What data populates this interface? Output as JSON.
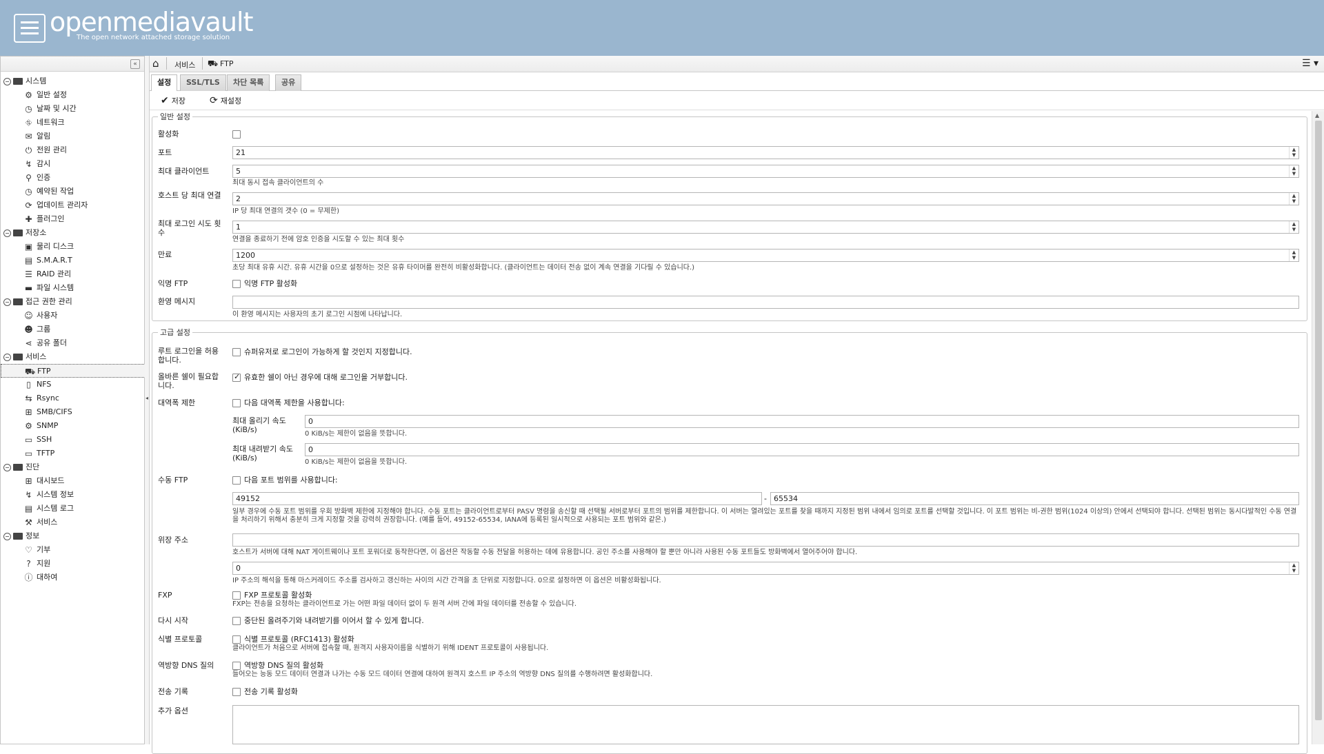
{
  "header": {
    "title": "openmediavault",
    "subtitle": "The open network attached storage solution"
  },
  "sidebar": {
    "categories": [
      {
        "label": "시스템",
        "items": [
          "일반 설정",
          "날짜 및 시간",
          "네트워크",
          "알림",
          "전원 관리",
          "감시",
          "인증",
          "예약된 작업",
          "업데이트 관리자",
          "플러그인"
        ]
      },
      {
        "label": "저장소",
        "items": [
          "물리 디스크",
          "S.M.A.R.T",
          "RAID 관리",
          "파일 시스템"
        ]
      },
      {
        "label": "접근 권한 관리",
        "items": [
          "사용자",
          "그룹",
          "공유 폴더"
        ]
      },
      {
        "label": "서비스",
        "items": [
          "FTP",
          "NFS",
          "Rsync",
          "SMB/CIFS",
          "SNMP",
          "SSH",
          "TFTP"
        ]
      },
      {
        "label": "진단",
        "items": [
          "대시보드",
          "시스템 정보",
          "시스템 로그",
          "서비스"
        ]
      },
      {
        "label": "정보",
        "items": [
          "기부",
          "지원",
          "대하여"
        ]
      }
    ]
  },
  "breadcrumb": {
    "services": "서비스",
    "ftp": "FTP"
  },
  "tabs": [
    "설정",
    "SSL/TLS",
    "차단 목록",
    "공유"
  ],
  "toolbar": {
    "save": "저장",
    "reset": "재설정"
  },
  "general": {
    "legend": "일반 설정",
    "enable_label": "활성화",
    "port_label": "포트",
    "port_value": "21",
    "maxclients_label": "최대 클라이언트",
    "maxclients_value": "5",
    "maxclients_hint": "최대 동시 접속 클라이언트의 수",
    "maxperhost_label": "호스트 당 최대 연결",
    "maxperhost_value": "2",
    "maxperhost_hint": "IP 당 최대 연결의 갯수 (0 = 무제한)",
    "maxlogin_label": "최대 로그인 시도 횟수",
    "maxlogin_value": "1",
    "maxlogin_hint": "연결을 종료하기 전에 암호 인증을 시도할 수 있는 최대 횟수",
    "timeout_label": "만료",
    "timeout_value": "1200",
    "timeout_hint": "초당 최대 유휴 시간. 유휴 시간을 0으로 설정하는 것은 유휴 타이머를 완전히 비활성화합니다. (클라이언트는 데이터 전송 없이 계속 연결을 기다릴 수 있습니다.)",
    "anon_label": "익명 FTP",
    "anon_cb": "익명 FTP 활성화",
    "welcome_label": "환영 메시지",
    "welcome_hint": "이 환영 메시지는 사용자의 초기 로그인 시점에 나타납니다."
  },
  "advanced": {
    "legend": "고급 설정",
    "rootlogin_label": "루트 로그인을 허용합니다.",
    "rootlogin_cb": "슈퍼유저로 로그인이 가능하게 할 것인지 지정합니다.",
    "shell_label": "올바른 쉘이 필요합니다.",
    "shell_cb": "유효한 쉘이 아닌 경우에 대해 로그인을 거부합니다.",
    "bw_label": "대역폭 제한",
    "bw_cb": "다음 대역폭 제한을 사용합니다:",
    "upload_label": "최대 올리기 속도 (KiB/s)",
    "upload_value": "0",
    "upload_hint": "0 KiB/s는 제한이 없음을 뜻합니다.",
    "download_label": "최대 내려받기 속도 (KiB/s)",
    "download_value": "0",
    "download_hint": "0 KiB/s는 제한이 없음을 뜻합니다.",
    "passive_label": "수동 FTP",
    "passive_cb": "다음 포트 범위를 사용합니다:",
    "port_min": "49152",
    "port_sep": "-",
    "port_max": "65534",
    "passive_hint": "일부 경우에 수동 포트 범위를 우회 방화벽 제한에 지정해야 합니다. 수동 포트는 클라이언트로부터 PASV 명령을 송신할 때 선택될 서버로부터 포트의 범위를 제한합니다. 이 서버는 열려있는 포트를 찾을 때까지 지정된 범위 내에서 임의로 포트를 선택할 것입니다. 이 포트 범위는 비-권한 범위(1024 이상의) 안에서 선택되야 합니다. 선택된 범위는 동시다발적인 수동 연결을 처리하기 위해서 충분히 크게 지정할 것을 강력히 권장합니다. (예를 들어, 49152-65534, IANA에 등록된 일시적으로 사용되는 포트 범위와 같은.)",
    "masq_label": "위장 주소",
    "masq_hint": "호스트가 서버에 대해 NAT 게이트웨이나 포트 포워더로 동작한다면, 이 옵션은 작동할 수동 전달을 허용하는 데에 유용합니다. 공인 주소를 사용해야 할 뿐만 아니라 사용된 수동 포트들도 방화벽에서 열어주어야 합니다.",
    "dyn_value": "0",
    "dyn_hint": "IP 주소의 해석을 통해 마스커레이드 주소를 검사하고 갱신하는 사이의 시간 간격을 초 단위로 지정합니다. 0으로 설정하면 이 옵션은 비활성화됩니다.",
    "fxp_label": "FXP",
    "fxp_cb": "FXP 프로토콜 활성화",
    "fxp_hint": "FXP는 전송을 요청하는 클라이언트로 가는 어떤 파일 데이터 없이 두 원격 서버 간에 파일 데이터를 전송할 수 있습니다.",
    "resume_label": "다시 시작",
    "resume_cb": "중단된 올려주기와 내려받기를 이어서 할 수 있게 합니다.",
    "ident_label": "식별 프로토콜",
    "ident_cb": "식별 프로토콜 (RFC1413) 활성화",
    "ident_hint": "클라이언트가 처음으로 서버에 접속할 때, 원격지 사용자이름을 식별하기 위해 IDENT 프로토콜이 사용됩니다.",
    "dns_label": "역방향 DNS 질의",
    "dns_cb": "역방향 DNS 질의 활성화",
    "dns_hint": "들어오는 능동 모드 데이터 연결과 나가는 수동 모드 데이터 연결에 대하여 원격지 호스트 IP 주소의 역방향 DNS 질의를 수행하려면 활성화합니다.",
    "xfer_label": "전송 기록",
    "xfer_cb": "전송 기록 활성화",
    "extra_label": "추가 옵션"
  }
}
